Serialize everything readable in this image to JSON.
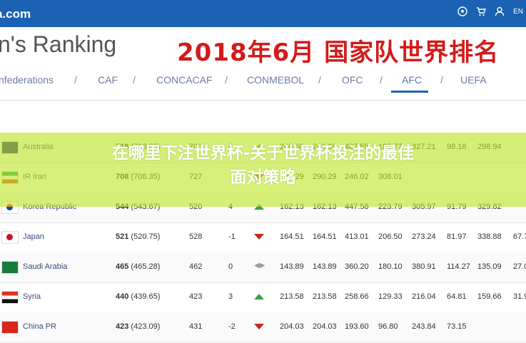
{
  "header": {
    "logo_text": "a.com",
    "lang": "EN"
  },
  "page": {
    "title": "n's Ranking",
    "overlay_title": "2018年6月 国家队世界排名"
  },
  "tabs": [
    {
      "label": "nfederations"
    },
    {
      "label": "CAF"
    },
    {
      "label": "CONCACAF"
    },
    {
      "label": "CONMEBOL"
    },
    {
      "label": "OFC"
    },
    {
      "label": "AFC",
      "active": true
    },
    {
      "label": "UEFA"
    }
  ],
  "table": {
    "rows": [
      {
        "team": "Australia",
        "pts_bold": "718",
        "pts_paren": "(718.83)",
        "prev": "700",
        "move": "4",
        "dir": "up",
        "c1": "246.60",
        "c2": "246.60",
        "c3": "487.55",
        "c4": "183.77",
        "c5": "327.21",
        "c6": "98.16",
        "c7": "298.94",
        "c8": ""
      },
      {
        "team": "IR Iran",
        "pts_bold": "708",
        "pts_paren": "(708.35)",
        "prev": "727",
        "move": "",
        "dir": "down",
        "c1": "290.29",
        "c2": "290.29",
        "c3": "246.02",
        "c4": "308.01",
        "c5": "",
        "c6": "",
        "c7": "",
        "c8": ""
      },
      {
        "team": "Korea Republic",
        "pts_bold": "544",
        "pts_paren": "(543.67)",
        "prev": "520",
        "move": "4",
        "dir": "up",
        "c1": "162.13",
        "c2": "162.13",
        "c3": "447.58",
        "c4": "223.79",
        "c5": "305.97",
        "c6": "91.79",
        "c7": "329.82",
        "c8": ""
      },
      {
        "team": "Japan",
        "pts_bold": "521",
        "pts_paren": "(520.75)",
        "prev": "528",
        "move": "-1",
        "dir": "down",
        "c1": "164.51",
        "c2": "164.51",
        "c3": "413.01",
        "c4": "206.50",
        "c5": "273.24",
        "c6": "81.97",
        "c7": "338.88",
        "c8": "67.7"
      },
      {
        "team": "Saudi Arabia",
        "pts_bold": "465",
        "pts_paren": "(465.28)",
        "prev": "462",
        "move": "0",
        "dir": "same",
        "c1": "143.89",
        "c2": "143.89",
        "c3": "360.20",
        "c4": "180.10",
        "c5": "380.91",
        "c6": "114.27",
        "c7": "135.09",
        "c8": "27.0"
      },
      {
        "team": "Syria",
        "pts_bold": "440",
        "pts_paren": "(439.65)",
        "prev": "423",
        "move": "3",
        "dir": "up",
        "c1": "213.58",
        "c2": "213.58",
        "c3": "258.66",
        "c4": "129.33",
        "c5": "216.04",
        "c6": "64.81",
        "c7": "159.66",
        "c8": "31.9"
      },
      {
        "team": "China PR",
        "pts_bold": "423",
        "pts_paren": "(423.09)",
        "prev": "431",
        "move": "-2",
        "dir": "down",
        "c1": "204.03",
        "c2": "204.03",
        "c3": "193.60",
        "c4": "96.80",
        "c5": "243.84",
        "c6": "73.15",
        "c7": "",
        "c8": ""
      }
    ]
  },
  "banner": {
    "line1": "在哪里下注世界杯-关于世界杯投注的最佳",
    "line2": "面对策略"
  },
  "colors": {
    "brand_blue": "#1c62b4",
    "title_red": "#d41a1a",
    "banner_green": "#bee628"
  },
  "icons": [
    "soccer-ball-icon",
    "cart-icon",
    "user-icon"
  ]
}
